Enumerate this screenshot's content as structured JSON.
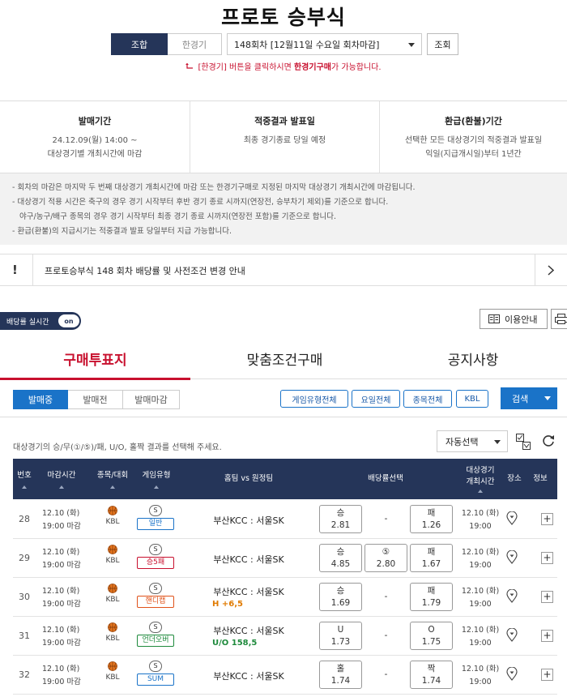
{
  "header": {
    "title": "프로토 승부식",
    "mode_combo": "조합",
    "mode_single": "한경기",
    "round_select": "148회차 [12월11일 수요일 회차마감]",
    "search_button": "조회",
    "hint_prefix": "[한경기] 버튼을 클릭하시면 ",
    "hint_bold": "한경기구매",
    "hint_suffix": "가 가능합니다."
  },
  "info": {
    "sale_period_title": "발매기간",
    "sale_period_line1": "24.12.09(월) 14:00 ~",
    "sale_period_line2": "대상경기별 개최시간에 마감",
    "result_title": "적중결과 발표일",
    "result_line1": "최종 경기종료 당일 예정",
    "refund_title": "환급(환불)기간",
    "refund_line1": "선택한 모든 대상경기의 적중결과 발표일",
    "refund_line2": "익일(지급개시일)부터 1년간"
  },
  "notes": [
    "- 회차의 마감은 마지막 두 번째 대상경기 개최시간에 마감 또는 한경기구매로 지정된 마지막 대상경기 개최시간에 마감됩니다.",
    "- 대상경기 적용 시간은 축구의 경우 경기 시작부터 후반 경기 종료 시까지(연장전, 승부차기 제외)를 기준으로 합니다.",
    "   야구/농구/배구 종목의 경우 경기 시작부터 최종 경기 종료 시까지(연장전 포함)를 기준으로 합니다.",
    "- 환급(환불)의 지급시기는 적중결과 발표 당일부터 지급 가능합니다."
  ],
  "notice": {
    "icon": "!",
    "text": "프로토승부식 148 회차 배당률 및 사전조건 변경 안내"
  },
  "toolbar": {
    "live_label": "배당률 실시간",
    "live_switch": "on",
    "guide": "이용안내"
  },
  "tabs": [
    "구매투표지",
    "맞춤조건구매",
    "공지사항"
  ],
  "filters": {
    "status": [
      "발매중",
      "발매전",
      "발매마감"
    ],
    "buttons": [
      "게임유형전체",
      "요일전체",
      "종목전체",
      "KBL"
    ],
    "search": "검색"
  },
  "instruction": "대상경기의 승/무(①/⑤)/패, U/O, 홀짝 결과를 선택해 주세요.",
  "auto_select": "자동선택",
  "table": {
    "headers": {
      "no": "번호",
      "deadline": "마감시간",
      "sport": "종목/대회",
      "game_type": "게임유형",
      "teams": "홈팀 vs 원정팀",
      "odds": "배당률선택",
      "match_time_1": "대상경기",
      "match_time_2": "개최시간",
      "venue": "장소",
      "info": "정보"
    },
    "rows": [
      {
        "no": "28",
        "deadline_date": "12.10 (화)",
        "deadline_time": "19:00 마감",
        "league": "KBL",
        "type_icon": "S",
        "type": "일반",
        "type_color": "#1a73c8",
        "teams": "부산KCC : 서울SK",
        "handicap": "",
        "handicap_color": "",
        "odd1_label": "승",
        "odd1": "2.81",
        "odd2_label": "",
        "odd2": "",
        "odd3_label": "패",
        "odd3": "1.26",
        "match_date": "12.10 (화)",
        "match_time": "19:00"
      },
      {
        "no": "29",
        "deadline_date": "12.10 (화)",
        "deadline_time": "19:00 마감",
        "league": "KBL",
        "type_icon": "S",
        "type": "승5패",
        "type_color": "#c8102e",
        "teams": "부산KCC : 서울SK",
        "handicap": "",
        "handicap_color": "",
        "odd1_label": "승",
        "odd1": "4.85",
        "odd2_label": "⑤",
        "odd2": "2.80",
        "odd3_label": "패",
        "odd3": "1.67",
        "match_date": "12.10 (화)",
        "match_time": "19:00"
      },
      {
        "no": "30",
        "deadline_date": "12.10 (화)",
        "deadline_time": "19:00 마감",
        "league": "KBL",
        "type_icon": "S",
        "type": "핸디캡",
        "type_color": "#e0521a",
        "teams": "부산KCC : 서울SK",
        "handicap": "H +6,5",
        "handicap_color": "#e07a00",
        "odd1_label": "승",
        "odd1": "1.69",
        "odd2_label": "",
        "odd2": "",
        "odd3_label": "패",
        "odd3": "1.79",
        "match_date": "12.10 (화)",
        "match_time": "19:00"
      },
      {
        "no": "31",
        "deadline_date": "12.10 (화)",
        "deadline_time": "19:00 마감",
        "league": "KBL",
        "type_icon": "S",
        "type": "언더오버",
        "type_color": "#1e8a3c",
        "teams": "부산KCC : 서울SK",
        "handicap": "U/O 158,5",
        "handicap_color": "#1e8a3c",
        "odd1_label": "U",
        "odd1": "1.73",
        "odd2_label": "",
        "odd2": "",
        "odd3_label": "O",
        "odd3": "1.75",
        "match_date": "12.10 (화)",
        "match_time": "19:00"
      },
      {
        "no": "32",
        "deadline_date": "12.10 (화)",
        "deadline_time": "19:00 마감",
        "league": "KBL",
        "type_icon": "S",
        "type": "SUM",
        "type_color": "#1a73c8",
        "teams": "부산KCC : 서울SK",
        "handicap": "",
        "handicap_color": "",
        "odd1_label": "홀",
        "odd1": "1.74",
        "odd2_label": "",
        "odd2": "",
        "odd3_label": "짝",
        "odd3": "1.74",
        "match_date": "12.10 (화)",
        "match_time": "19:00"
      }
    ],
    "draw_dash": "-",
    "plus": "+"
  },
  "colors": {
    "navy": "#253559",
    "accent_red": "#c8102e",
    "blue": "#1a73c8"
  }
}
